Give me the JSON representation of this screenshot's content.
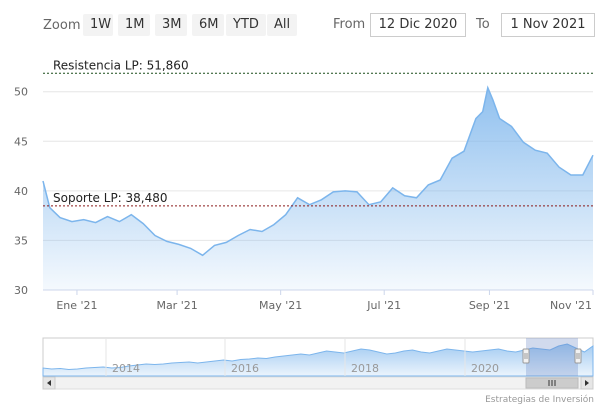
{
  "toolbar": {
    "zoom_label": "Zoom",
    "zoom_buttons": [
      "1W",
      "1M",
      "3M",
      "6M",
      "YTD",
      "All"
    ],
    "from_label": "From",
    "from_value": "12 Dic 2020",
    "to_label": "To",
    "to_value": "1 Nov 2021"
  },
  "chart_data": {
    "type": "area",
    "y_ticks": [
      "50",
      "45",
      "40",
      "35",
      "30"
    ],
    "x_ticks": [
      "Ene '21",
      "Mar '21",
      "May '21",
      "Jul '21",
      "Sep '21",
      "Nov '21"
    ],
    "ylim": [
      30,
      53
    ],
    "grid": true,
    "series_color": "#7cb5ec",
    "annotations": {
      "resistance_label": "Resistencia LP: 51,860",
      "resistance_value": 51.86,
      "support_label": "Soporte LP: 38,480",
      "support_value": 38.48
    },
    "series": [
      {
        "values": [
          [
            "2020-12-12",
            41.0
          ],
          [
            "2020-12-16",
            38.3
          ],
          [
            "2020-12-22",
            37.3
          ],
          [
            "2020-12-29",
            36.9
          ],
          [
            "2021-01-05",
            37.1
          ],
          [
            "2021-01-12",
            36.8
          ],
          [
            "2021-01-19",
            37.4
          ],
          [
            "2021-01-26",
            36.9
          ],
          [
            "2021-02-02",
            37.6
          ],
          [
            "2021-02-09",
            36.7
          ],
          [
            "2021-02-16",
            35.5
          ],
          [
            "2021-02-23",
            34.9
          ],
          [
            "2021-03-02",
            34.6
          ],
          [
            "2021-03-09",
            34.2
          ],
          [
            "2021-03-16",
            33.5
          ],
          [
            "2021-03-23",
            34.5
          ],
          [
            "2021-03-30",
            34.8
          ],
          [
            "2021-04-06",
            35.5
          ],
          [
            "2021-04-13",
            36.1
          ],
          [
            "2021-04-20",
            35.9
          ],
          [
            "2021-04-27",
            36.6
          ],
          [
            "2021-05-04",
            37.6
          ],
          [
            "2021-05-11",
            39.3
          ],
          [
            "2021-05-18",
            38.6
          ],
          [
            "2021-05-25",
            39.1
          ],
          [
            "2021-06-01",
            39.9
          ],
          [
            "2021-06-08",
            40.0
          ],
          [
            "2021-06-15",
            39.9
          ],
          [
            "2021-06-22",
            38.6
          ],
          [
            "2021-06-29",
            38.9
          ],
          [
            "2021-07-06",
            40.3
          ],
          [
            "2021-07-13",
            39.5
          ],
          [
            "2021-07-20",
            39.3
          ],
          [
            "2021-07-27",
            40.6
          ],
          [
            "2021-08-03",
            41.1
          ],
          [
            "2021-08-10",
            43.3
          ],
          [
            "2021-08-17",
            44.0
          ],
          [
            "2021-08-24",
            47.3
          ],
          [
            "2021-08-28",
            48.0
          ],
          [
            "2021-08-31",
            50.4
          ],
          [
            "2021-09-03",
            49.2
          ],
          [
            "2021-09-07",
            47.3
          ],
          [
            "2021-09-14",
            46.5
          ],
          [
            "2021-09-21",
            44.9
          ],
          [
            "2021-09-28",
            44.1
          ],
          [
            "2021-10-05",
            43.8
          ],
          [
            "2021-10-12",
            42.4
          ],
          [
            "2021-10-19",
            41.6
          ],
          [
            "2021-10-26",
            41.6
          ],
          [
            "2021-11-01",
            43.6
          ]
        ]
      }
    ],
    "navigator": {
      "x_ticks": [
        "2014",
        "2016",
        "2018",
        "2020"
      ]
    }
  },
  "credit": "Estrategias de Inversión"
}
